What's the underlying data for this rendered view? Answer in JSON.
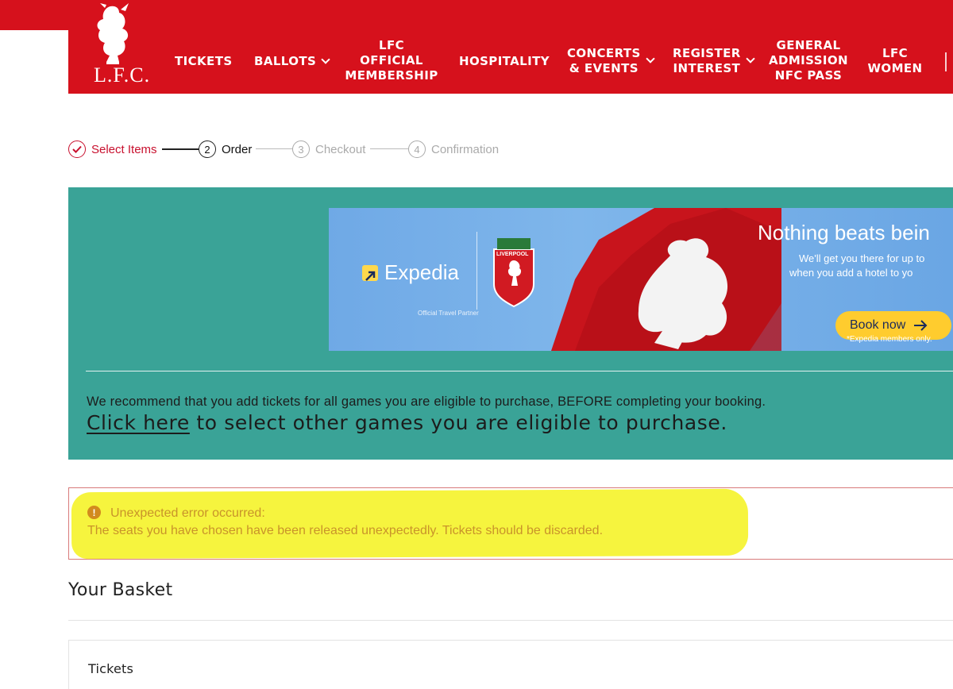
{
  "brand": {
    "logo_text": "L.F.C.",
    "primary_color": "#d6111c",
    "teal_color": "#3aa397"
  },
  "nav": {
    "tickets": [
      "TICKETS"
    ],
    "ballots": [
      "BALLOTS"
    ],
    "membership": [
      "LFC",
      "OFFICIAL",
      "MEMBERSHIP"
    ],
    "hospitality": [
      "HOSPITALITY"
    ],
    "concerts": [
      "CONCERTS",
      "& EVENTS"
    ],
    "register": [
      "REGISTER",
      "INTEREST"
    ],
    "general": [
      "GENERAL",
      "ADMISSION",
      "NFC PASS"
    ],
    "women": [
      "LFC",
      "WOMEN"
    ]
  },
  "stepper": {
    "step1": {
      "label": "Select Items",
      "state": "complete"
    },
    "step2": {
      "number": "2",
      "label": "Order",
      "state": "current"
    },
    "step3": {
      "number": "3",
      "label": "Checkout",
      "state": "upcoming"
    },
    "step4": {
      "number": "4",
      "label": "Confirmation",
      "state": "upcoming"
    }
  },
  "banner": {
    "partner_name": "Expedia",
    "partner_caption": "Official Travel Partner",
    "club_crest_text": "LIVERPOOL",
    "headline": "Nothing beats bein",
    "body_line_1": "We'll get you there for up to",
    "body_line_2": "when you add a hotel to yo",
    "cta_label": "Book now",
    "footnote": "*Expedia members only."
  },
  "promo": {
    "recommend_text": "We recommend that you add tickets for all games you are eligible to purchase, BEFORE completing your booking.",
    "link_label": "Click here",
    "link_suffix": " to select other games you are eligible to purchase."
  },
  "error": {
    "icon": "!",
    "title": "Unexpected error occurred:",
    "message": "The seats you have chosen have been released unexpectedly. Tickets should be discarded."
  },
  "basket": {
    "title": "Your Basket",
    "tickets_label": "Tickets"
  }
}
